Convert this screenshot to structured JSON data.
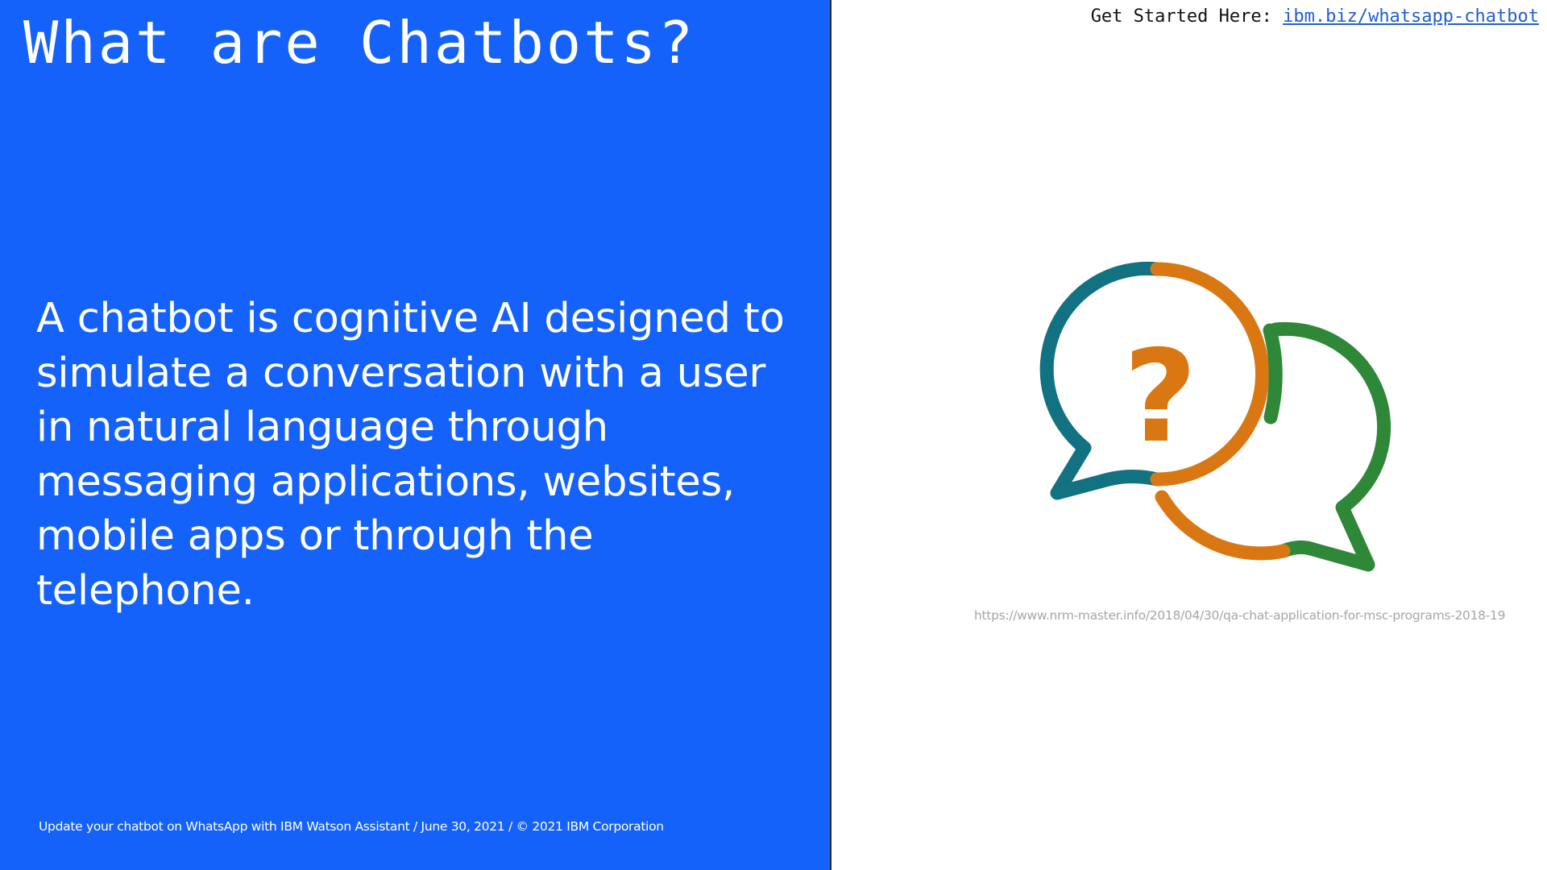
{
  "slide": {
    "title": "What are Chatbots?",
    "body": "A chatbot is cognitive AI designed to simulate a conversation with a user in natural language through messaging applications, websites, mobile apps or through the telephone.",
    "footer": "Update your chatbot on WhatsApp with IBM Watson Assistant / June 30, 2021 / © 2021 IBM Corporation"
  },
  "header_link": {
    "prefix": "Get Started Here: ",
    "link_text": "ibm.biz/whatsapp-chatbot"
  },
  "graphic": {
    "icon": "chat-bubbles-question-icon",
    "glyph": "?",
    "colors": {
      "teal": "#127282",
      "orange": "#d97813",
      "green": "#2f8738"
    },
    "caption": "https://www.nrm-master.info/2018/04/30/qa-chat-application-for-msc-programs-2018-19"
  },
  "colors": {
    "panel_background": "#1562fb",
    "link": "#1f5fd6"
  }
}
